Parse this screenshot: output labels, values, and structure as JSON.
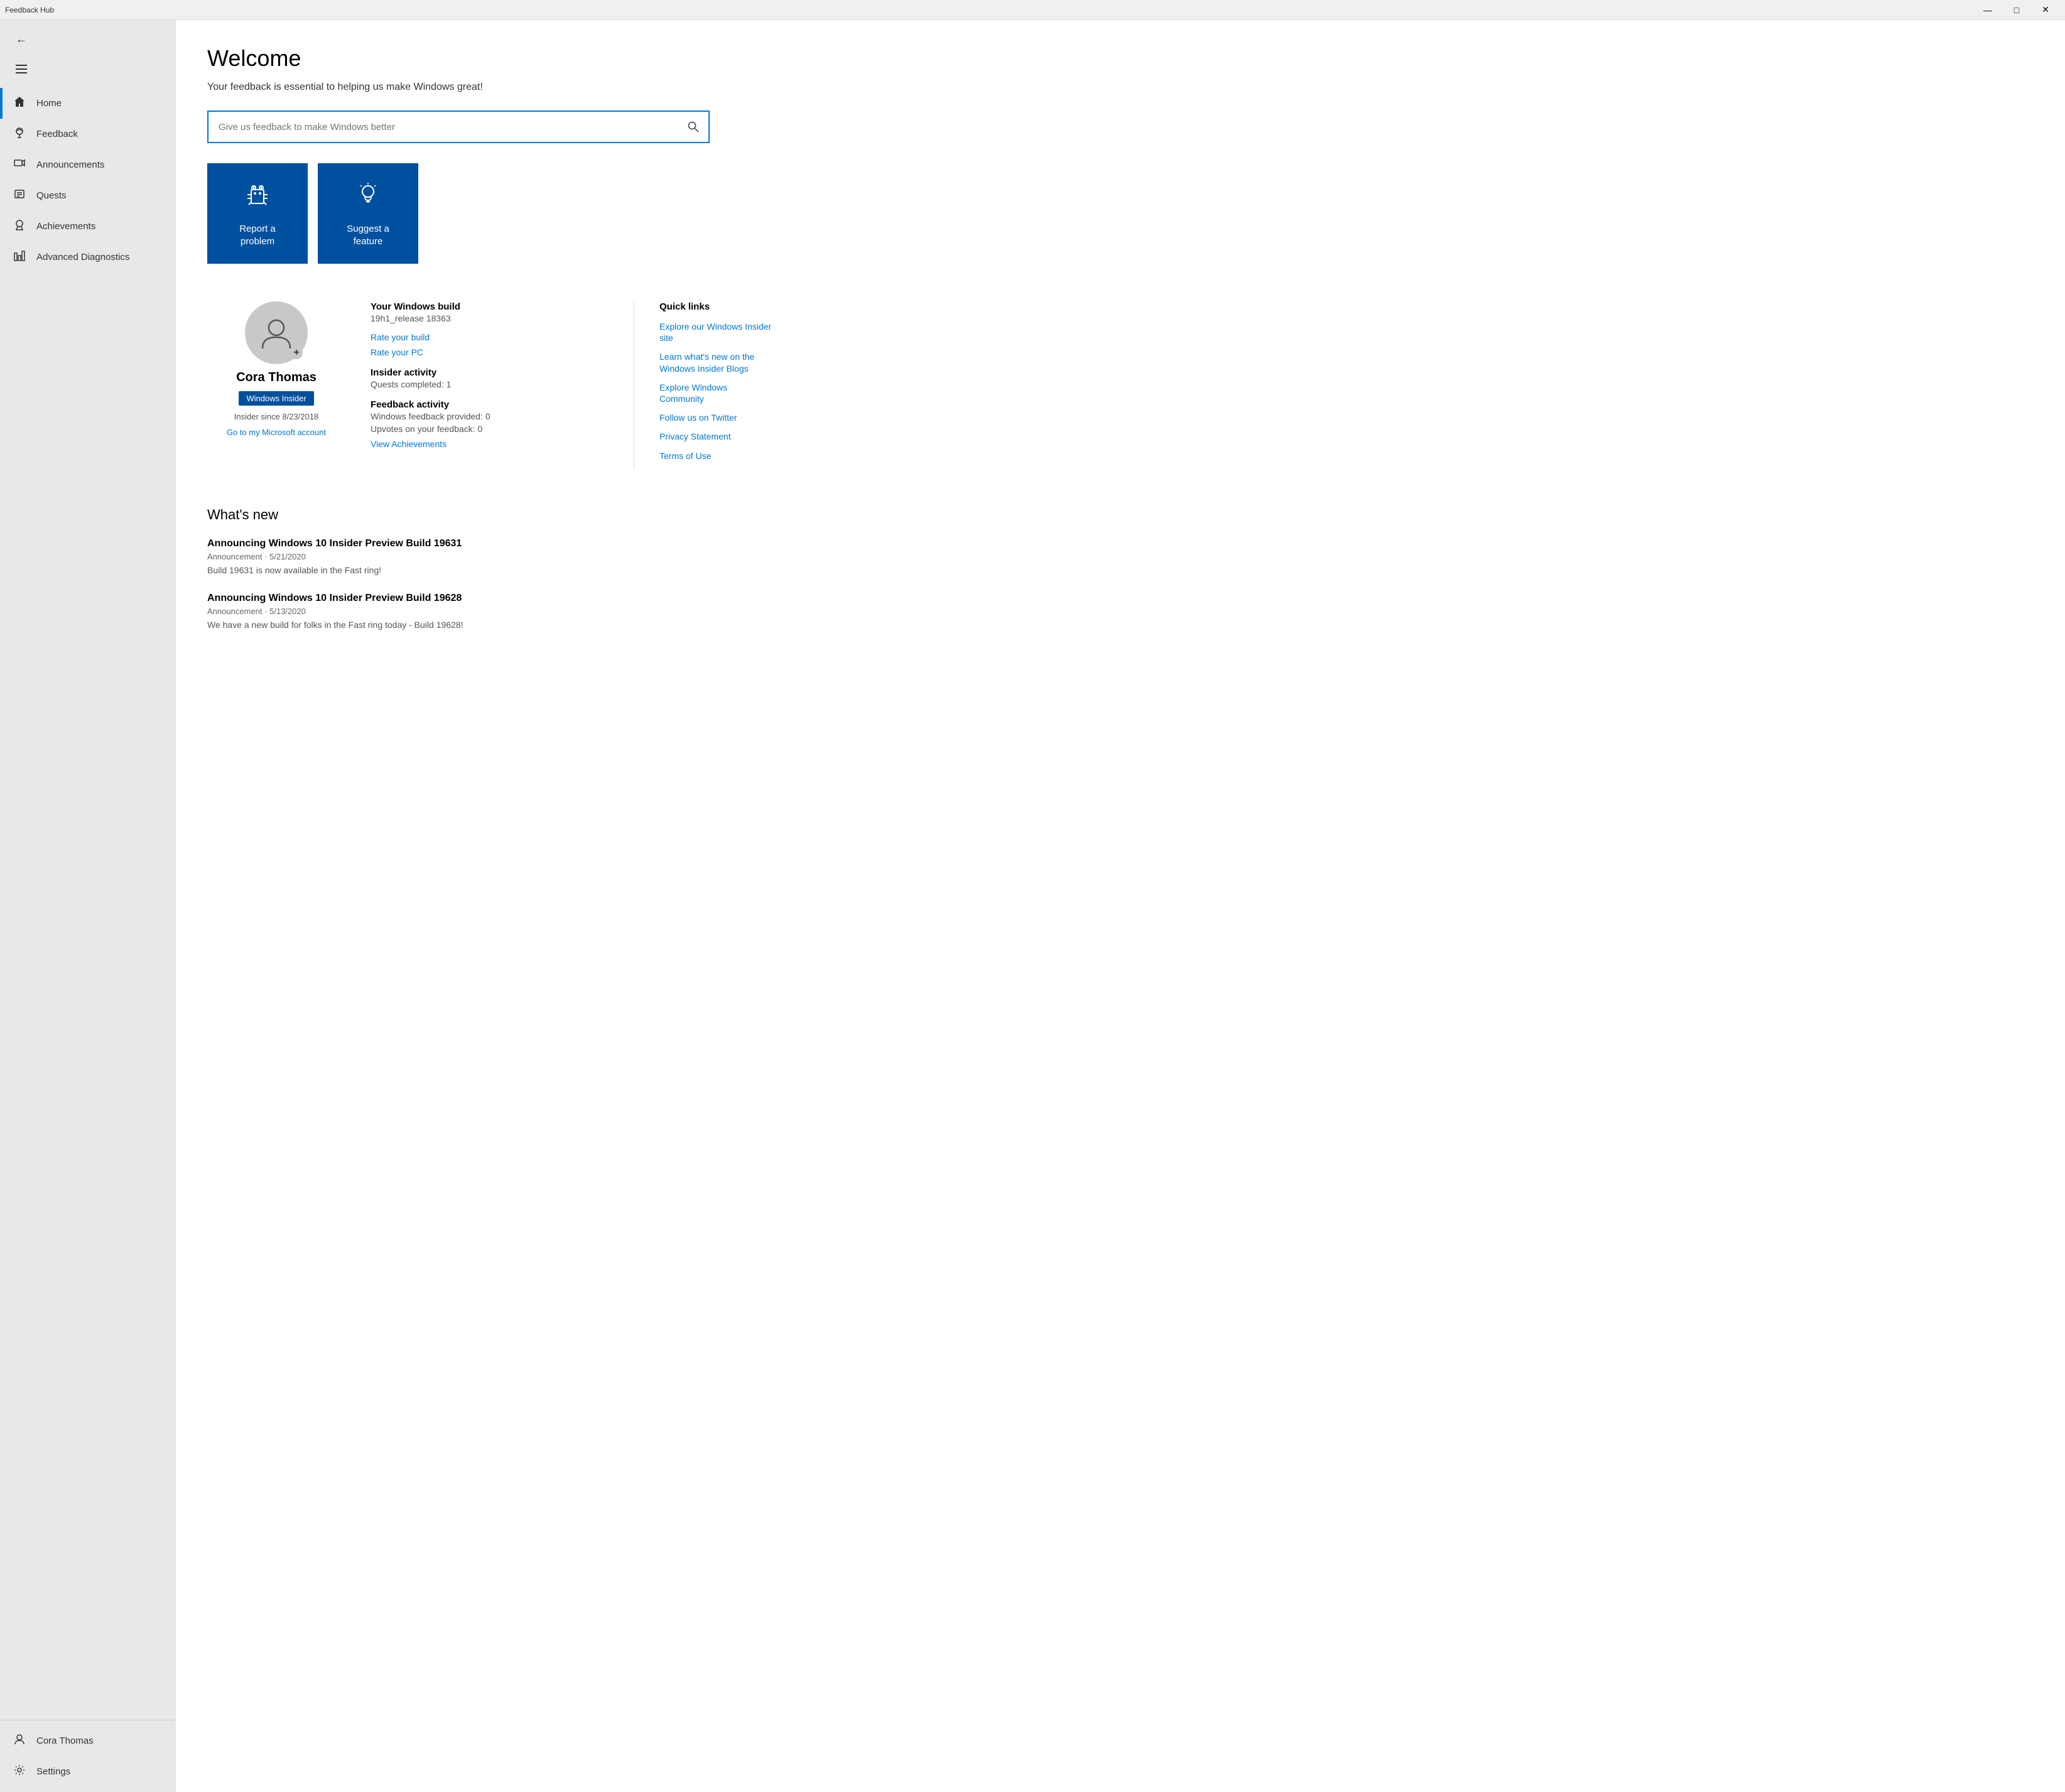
{
  "titlebar": {
    "title": "Feedback Hub",
    "minimize_label": "minimize",
    "maximize_label": "maximize",
    "close_label": "close"
  },
  "sidebar": {
    "nav_items": [
      {
        "id": "home",
        "label": "Home",
        "active": true
      },
      {
        "id": "feedback",
        "label": "Feedback",
        "active": false
      },
      {
        "id": "announcements",
        "label": "Announcements",
        "active": false
      },
      {
        "id": "quests",
        "label": "Quests",
        "active": false
      },
      {
        "id": "achievements",
        "label": "Achievements",
        "active": false
      },
      {
        "id": "advanced-diagnostics",
        "label": "Advanced Diagnostics",
        "active": false
      }
    ],
    "bottom_items": [
      {
        "id": "user",
        "label": "Cora Thomas"
      },
      {
        "id": "settings",
        "label": "Settings"
      }
    ]
  },
  "main": {
    "welcome_title": "Welcome",
    "welcome_subtitle": "Your feedback is essential to helping us make Windows great!",
    "search_placeholder": "Give us feedback to make Windows better",
    "action_cards": [
      {
        "id": "report-problem",
        "label": "Report a\nproblem"
      },
      {
        "id": "suggest-feature",
        "label": "Suggest a\nfeature"
      }
    ],
    "profile": {
      "name": "Cora Thomas",
      "badge": "Windows Insider",
      "insider_since": "Insider since 8/23/2018",
      "account_link": "Go to my Microsoft account",
      "build_title": "Your Windows build",
      "build_value": "19h1_release 18363",
      "rate_build_label": "Rate your build",
      "rate_pc_label": "Rate your PC",
      "insider_activity_title": "Insider activity",
      "quests_completed": "Quests completed: 1",
      "feedback_activity_title": "Feedback activity",
      "feedback_provided": "Windows feedback provided: 0",
      "upvotes": "Upvotes on your feedback: 0",
      "view_achievements_label": "View Achievements"
    },
    "quick_links": {
      "title": "Quick links",
      "items": [
        {
          "id": "explore-insider",
          "label": "Explore our Windows Insider site"
        },
        {
          "id": "insider-blogs",
          "label": "Learn what's new on the Windows Insider Blogs"
        },
        {
          "id": "windows-community",
          "label": "Explore Windows Community"
        },
        {
          "id": "twitter",
          "label": "Follow us on Twitter"
        },
        {
          "id": "privacy",
          "label": "Privacy Statement"
        },
        {
          "id": "terms",
          "label": "Terms of Use"
        }
      ]
    },
    "whats_new": {
      "title": "What's new",
      "items": [
        {
          "title": "Announcing Windows 10 Insider Preview Build 19631",
          "meta": "Announcement · 5/21/2020",
          "desc": "Build 19631 is now available in the Fast ring!"
        },
        {
          "title": "Announcing Windows 10 Insider Preview Build 19628",
          "meta": "Announcement · 5/13/2020",
          "desc": "We have a new build for folks in the Fast ring today - Build 19628!"
        }
      ]
    }
  }
}
